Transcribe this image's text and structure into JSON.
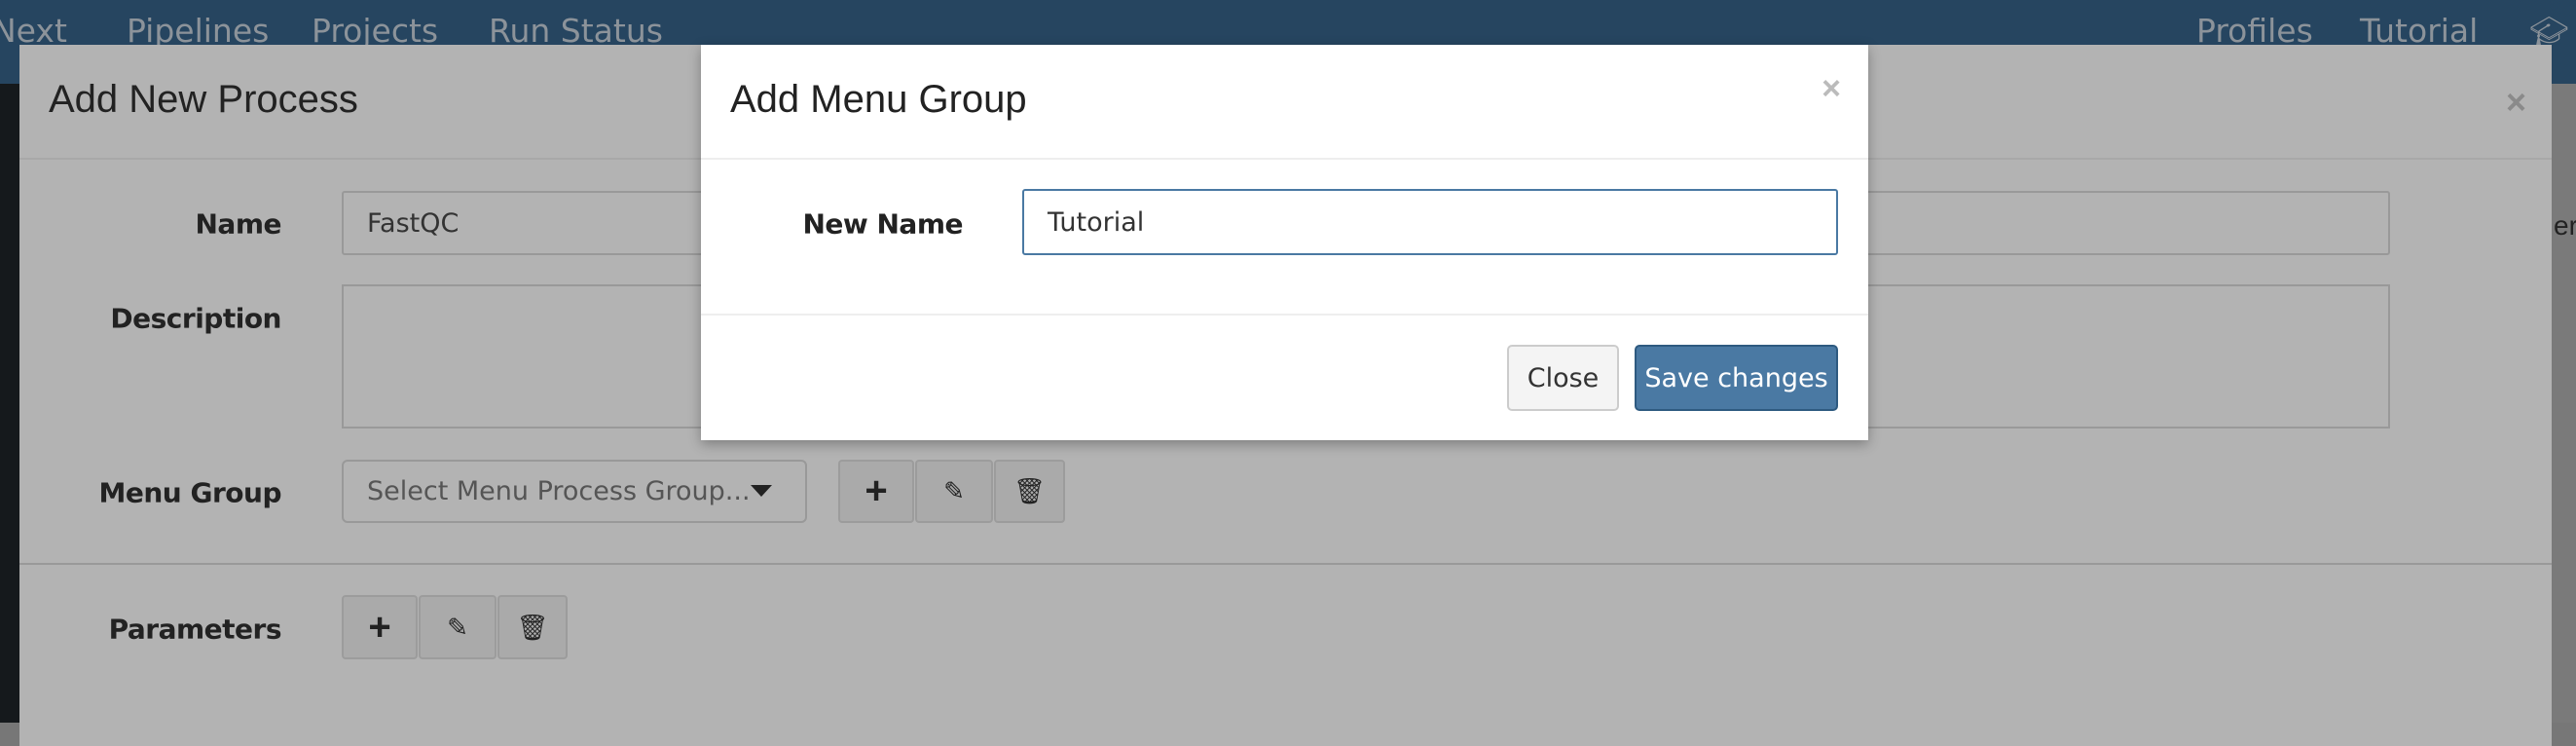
{
  "navbar": {
    "brand": "Next",
    "items": [
      "Pipelines",
      "Projects",
      "Run Status"
    ],
    "right_items": [
      "Profiles",
      "Tutorial"
    ],
    "icon": "graduation-cap-icon",
    "bg": "#264560"
  },
  "background_fragments": {
    "right": "erv"
  },
  "process_modal": {
    "title": "Add New Process",
    "name_label": "Name",
    "name_value": "FastQC",
    "description_label": "Description",
    "description_value": "",
    "menu_group_label": "Menu Group",
    "menu_group_placeholder": "Select Menu Process Group...",
    "parameters_label": "Parameters"
  },
  "menu_group_modal": {
    "title": "Add Menu Group",
    "new_name_label": "New Name",
    "new_name_value": "Tutorial",
    "close_label": "Close",
    "save_label": "Save changes",
    "save_color": "#4a79a3"
  }
}
